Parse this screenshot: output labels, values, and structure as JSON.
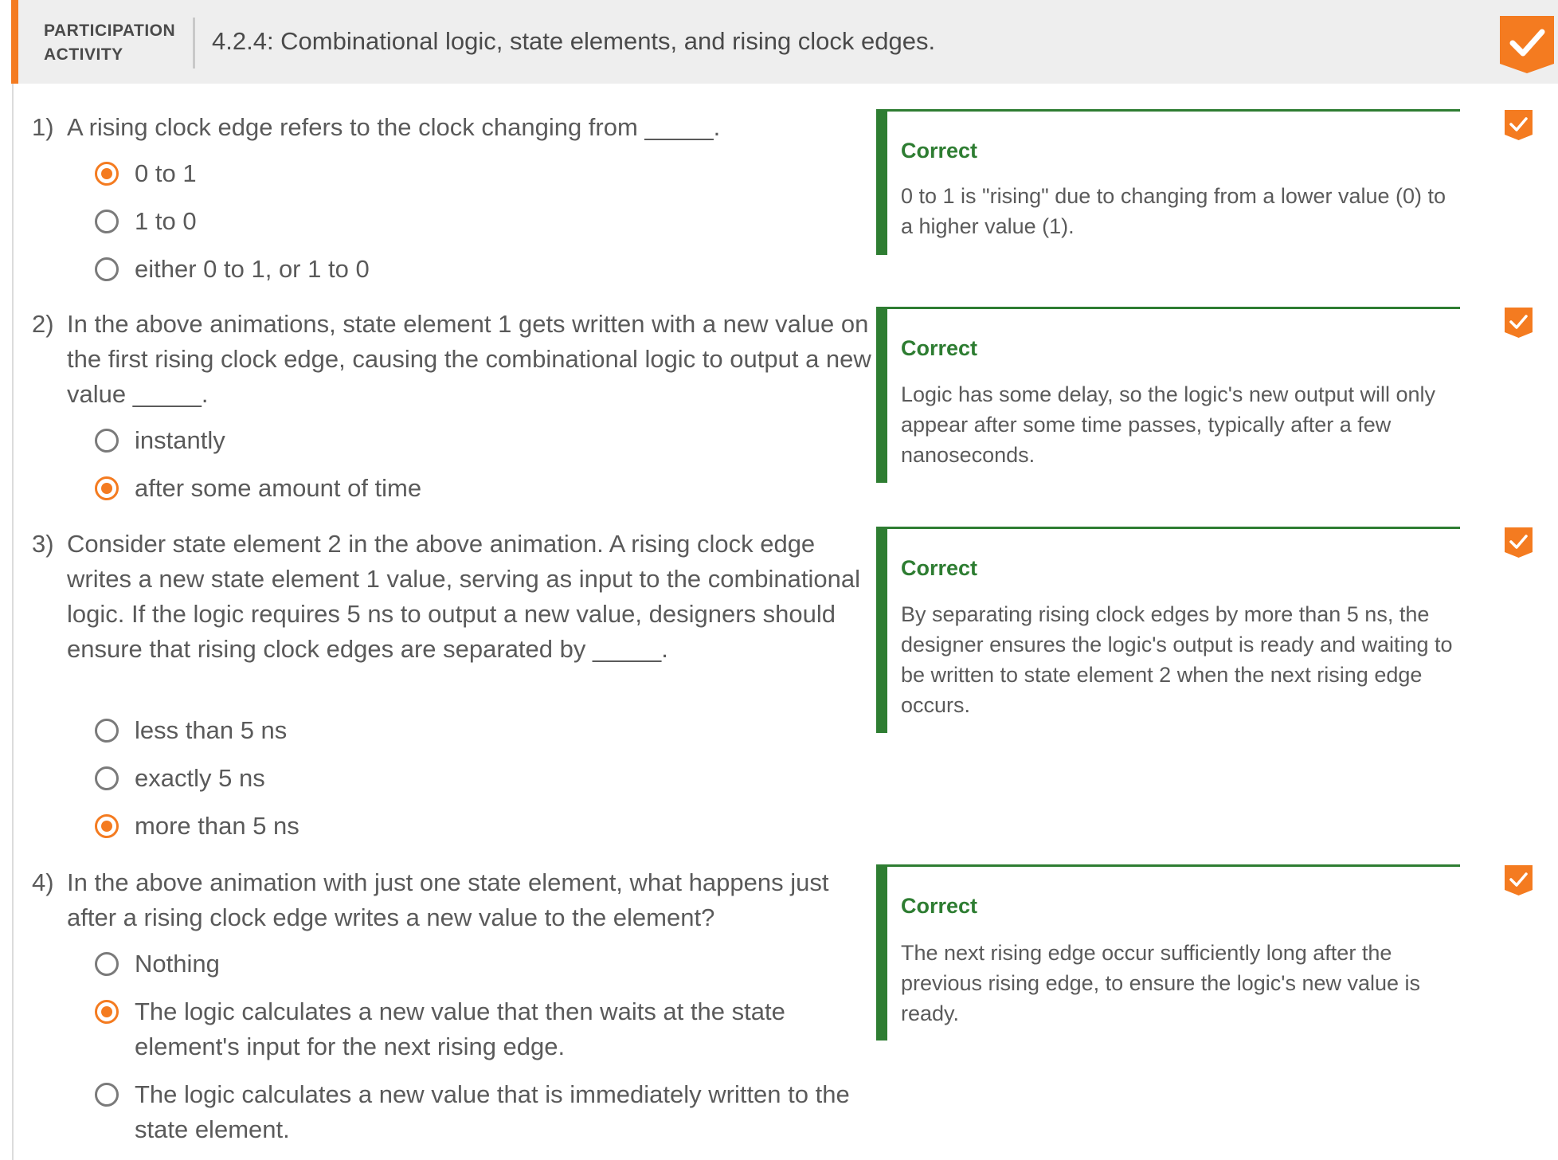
{
  "header": {
    "label_line1": "PARTICIPATION",
    "label_line2": "ACTIVITY",
    "title": "4.2.4: Combinational logic, state elements, and rising clock edges.",
    "accent_color": "#f47b20",
    "completion_icon": "check-icon"
  },
  "questions": [
    {
      "number": "1)",
      "text": "A rising clock edge refers to the clock changing from _____.",
      "options": [
        {
          "label": "0 to 1",
          "selected": true
        },
        {
          "label": "1 to 0",
          "selected": false
        },
        {
          "label": "either 0 to 1, or 1 to 0",
          "selected": false
        }
      ],
      "feedback": {
        "title": "Correct",
        "text": "0 to 1 is \"rising\" due to changing from a lower value (0) to a higher value (1)."
      }
    },
    {
      "number": "2)",
      "text": "In the above animations, state element 1 gets written with a new value on the first rising clock edge, causing the combinational logic to output a new value _____.",
      "options": [
        {
          "label": "instantly",
          "selected": false
        },
        {
          "label": "after some amount of time",
          "selected": true
        }
      ],
      "feedback": {
        "title": "Correct",
        "text": "Logic has some delay, so the logic's new output will only appear after some time passes, typically after a few nanoseconds."
      }
    },
    {
      "number": "3)",
      "text": "Consider state element 2 in the above animation. A rising clock edge writes a new state element 1 value, serving as input to the combinational logic. If the logic requires 5 ns to output a new value, designers should ensure that rising clock edges are separated by _____.",
      "options": [
        {
          "label": "less than 5 ns",
          "selected": false
        },
        {
          "label": "exactly 5 ns",
          "selected": false
        },
        {
          "label": "more than 5 ns",
          "selected": true
        }
      ],
      "feedback": {
        "title": "Correct",
        "text": "By separating rising clock edges by more than 5 ns, the designer ensures the logic's output is ready and waiting to be written to state element 2 when the next rising edge occurs."
      }
    },
    {
      "number": "4)",
      "text": "In the above animation with just one state element, what happens just after a rising clock edge writes a new value to the element?",
      "options": [
        {
          "label": "Nothing",
          "selected": false
        },
        {
          "label": "The logic calculates a new value that then waits at the state element's input for the next rising edge.",
          "selected": true
        },
        {
          "label": "The logic calculates a new value that is immediately written to the state element.",
          "selected": false
        }
      ],
      "feedback": {
        "title": "Correct",
        "text": "The next rising edge occur sufficiently long after the previous rising edge, to ensure the logic's new value is ready."
      }
    }
  ],
  "colors": {
    "accent": "#f47b20",
    "correct_green": "#2e7d32",
    "header_bg": "#eeeeee",
    "text": "#5a5a5a"
  }
}
